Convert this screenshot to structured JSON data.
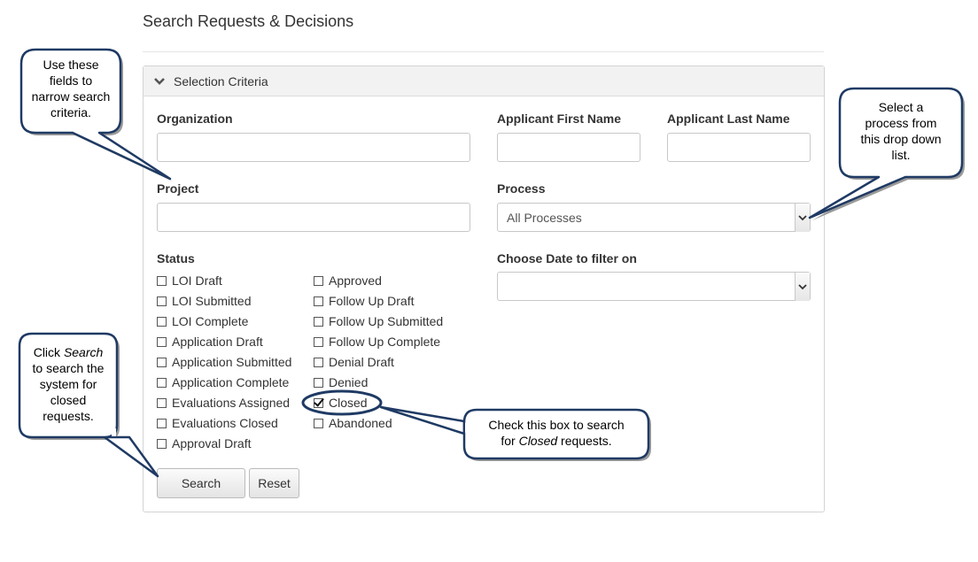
{
  "page": {
    "title": "Search Requests & Decisions"
  },
  "panel": {
    "header": "Selection Criteria"
  },
  "fields": {
    "organization": {
      "label": "Organization",
      "value": ""
    },
    "applicant_first_name": {
      "label": "Applicant First Name",
      "value": ""
    },
    "applicant_last_name": {
      "label": "Applicant Last Name",
      "value": ""
    },
    "project": {
      "label": "Project",
      "value": ""
    },
    "process": {
      "label": "Process",
      "value": "All Processes"
    },
    "date_filter": {
      "label": "Choose Date to filter on",
      "value": ""
    }
  },
  "status": {
    "label": "Status",
    "col1": [
      {
        "label": "LOI Draft",
        "checked": false
      },
      {
        "label": "LOI Submitted",
        "checked": false
      },
      {
        "label": "LOI Complete",
        "checked": false
      },
      {
        "label": "Application Draft",
        "checked": false
      },
      {
        "label": "Application Submitted",
        "checked": false
      },
      {
        "label": "Application Complete",
        "checked": false
      },
      {
        "label": "Evaluations Assigned",
        "checked": false
      },
      {
        "label": "Evaluations Closed",
        "checked": false
      },
      {
        "label": "Approval Draft",
        "checked": false
      }
    ],
    "col2": [
      {
        "label": "Approved",
        "checked": false
      },
      {
        "label": "Follow Up Draft",
        "checked": false
      },
      {
        "label": "Follow Up Submitted",
        "checked": false
      },
      {
        "label": "Follow Up Complete",
        "checked": false
      },
      {
        "label": "Denial Draft",
        "checked": false
      },
      {
        "label": "Denied",
        "checked": false
      },
      {
        "label": "Closed",
        "checked": true
      },
      {
        "label": "Abandoned",
        "checked": false
      }
    ]
  },
  "buttons": {
    "search": "Search",
    "reset": "Reset"
  },
  "callouts": {
    "narrow": [
      "Use these",
      "fields to",
      "narrow search",
      "criteria."
    ],
    "process": [
      "Select a",
      "process from",
      "this drop down",
      "list."
    ],
    "search_pre": "Click ",
    "search_em": "Search",
    "search_rest": [
      "to  search the",
      "system for",
      "closed",
      "requests."
    ],
    "closed_line1": "Check this box to search",
    "closed_pre": "for ",
    "closed_em": "Closed",
    "closed_post": " requests."
  },
  "colors": {
    "callout_border": "#1f3a64",
    "shadow": "#9a9a9a"
  }
}
